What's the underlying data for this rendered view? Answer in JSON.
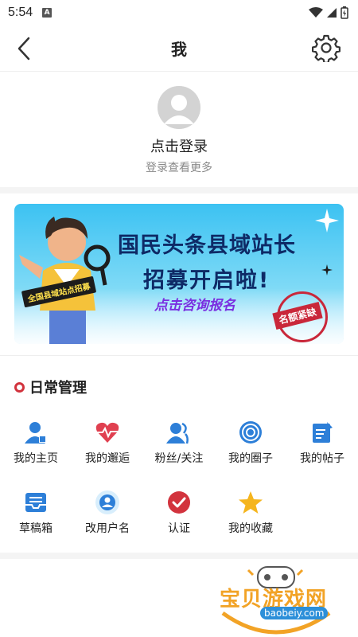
{
  "status": {
    "time": "5:54",
    "notif_badge": "A"
  },
  "header": {
    "title": "我"
  },
  "profile": {
    "login": "点击登录",
    "login_sub": "登录查看更多"
  },
  "banner": {
    "line1": "国民头条县域站长",
    "line2": "招募开启啦!",
    "cta": "点击咨询报名",
    "recruit_tag": "全国县域站点招募",
    "stamp": "名额紧缺"
  },
  "section": {
    "title": "日常管理"
  },
  "grid": [
    {
      "label": "我的主页",
      "icon": "user-home-icon"
    },
    {
      "label": "我的邂逅",
      "icon": "heart-pulse-icon"
    },
    {
      "label": "粉丝/关注",
      "icon": "followers-icon"
    },
    {
      "label": "我的圈子",
      "icon": "circle-target-icon"
    },
    {
      "label": "我的帖子",
      "icon": "post-edit-icon"
    },
    {
      "label": "草稿箱",
      "icon": "draft-box-icon"
    },
    {
      "label": "改用户名",
      "icon": "rename-user-icon"
    },
    {
      "label": "认证",
      "icon": "verify-check-icon"
    },
    {
      "label": "我的收藏",
      "icon": "star-icon"
    }
  ],
  "watermark": {
    "main": "宝贝游戏网",
    "url": "baobeiy.com"
  },
  "colors": {
    "accent_red": "#d2333d",
    "icon_blue": "#2d7fd8",
    "banner_blue": "#3cc2f2"
  }
}
